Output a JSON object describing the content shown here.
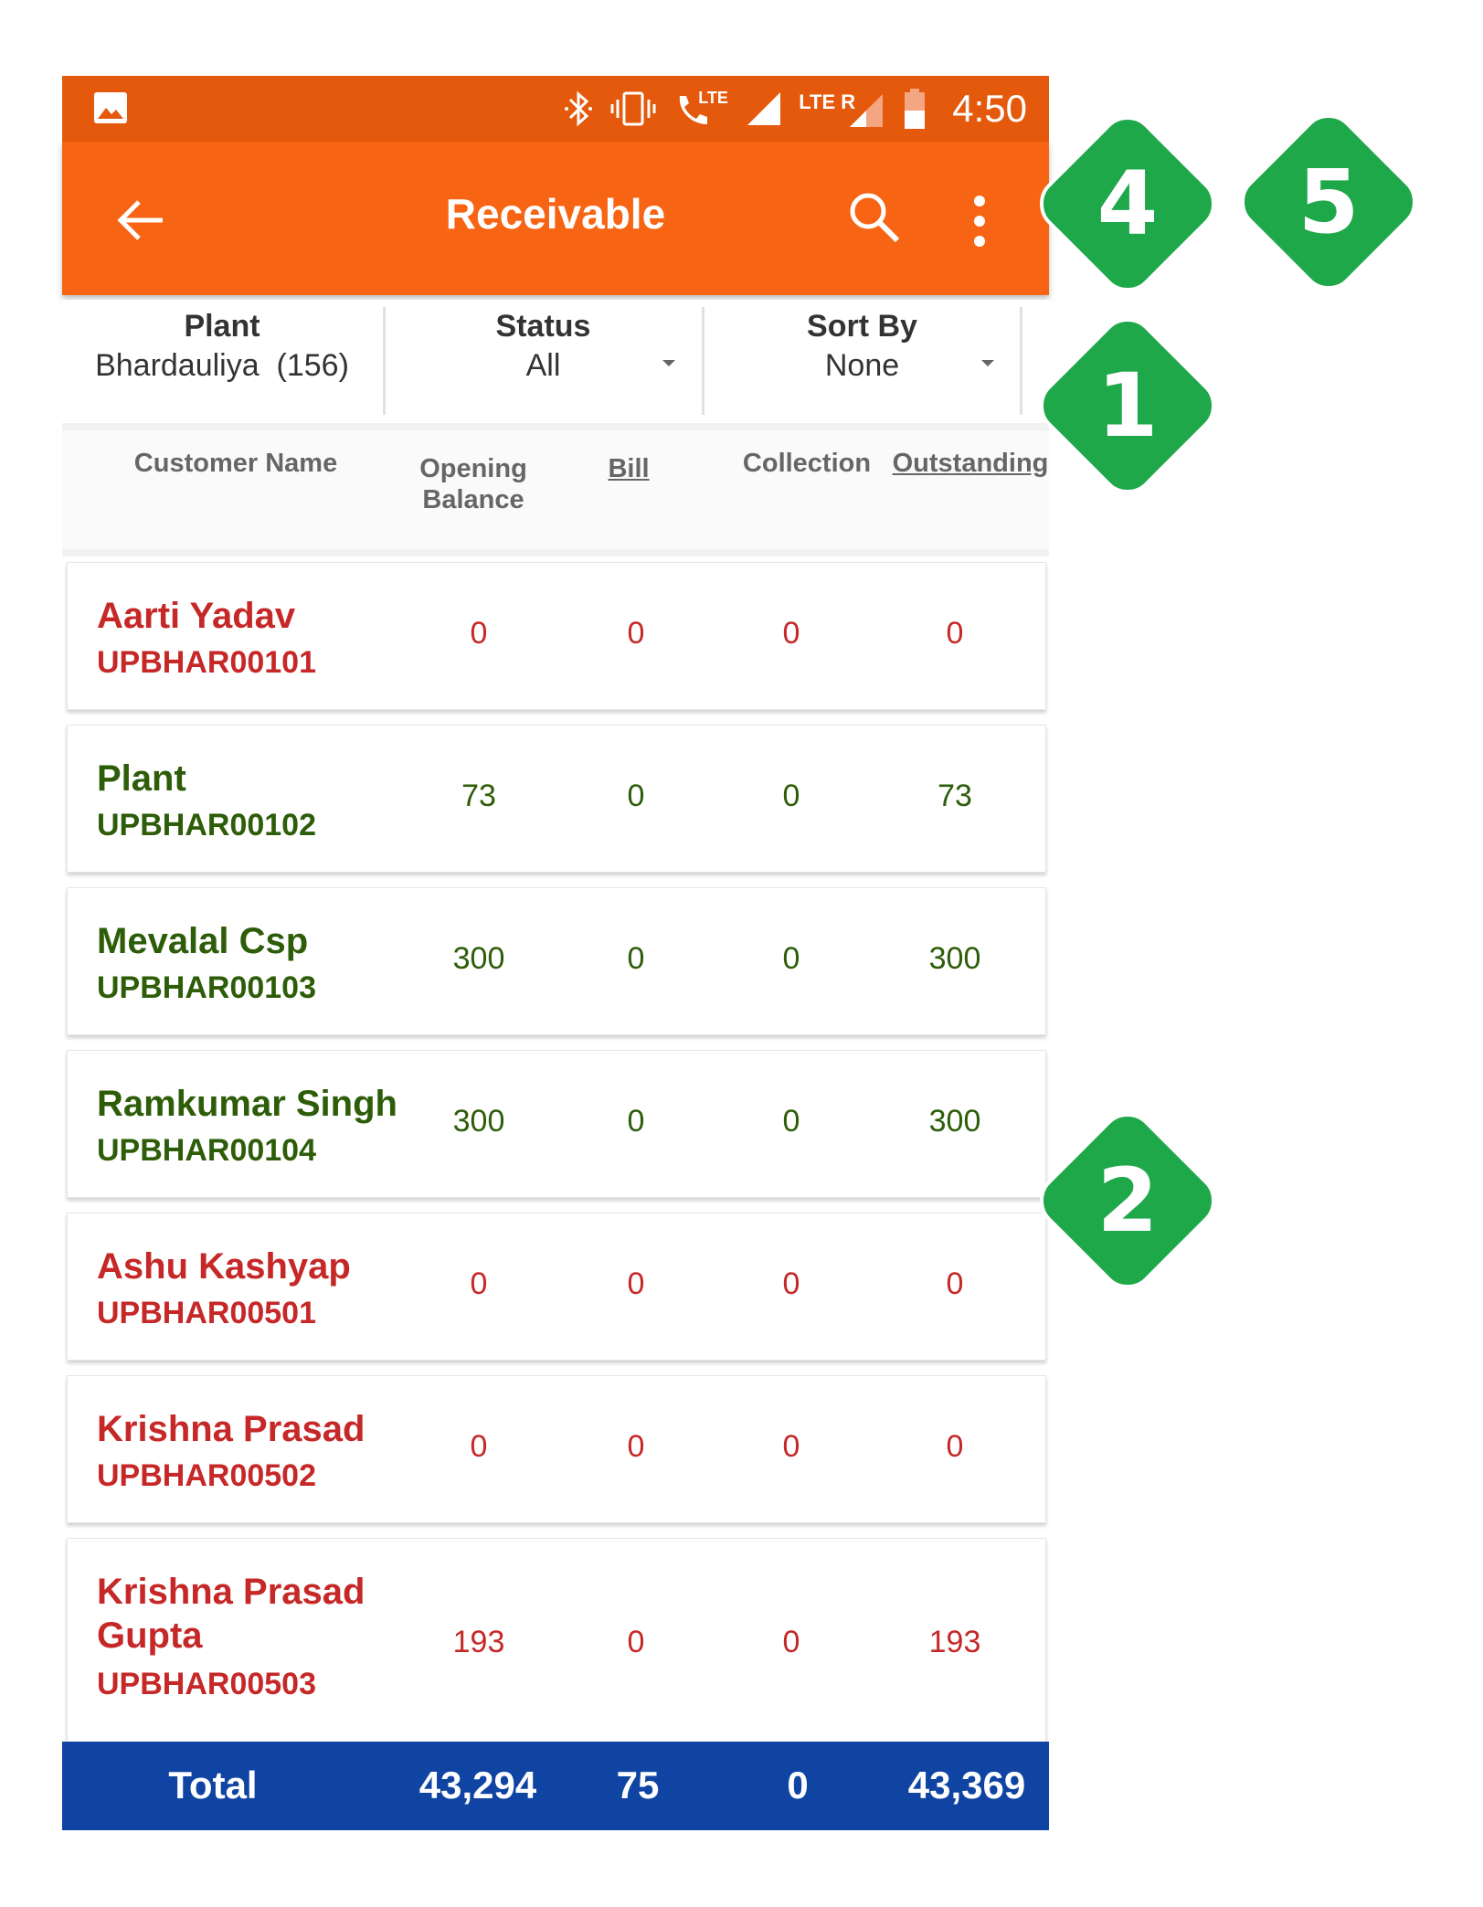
{
  "status_bar": {
    "time": "4:50",
    "lte": "LTE",
    "lte_r": "LTE R",
    "call_lte": "LTE"
  },
  "app_bar": {
    "title": "Receivable"
  },
  "filters": {
    "plant": {
      "label": "Plant",
      "value": "Bhardauliya  (156)"
    },
    "status": {
      "label": "Status",
      "value": "All"
    },
    "sort_by": {
      "label": "Sort By",
      "value": "None"
    }
  },
  "columns": {
    "customer_name": "Customer Name",
    "opening_balance_1": "Opening",
    "opening_balance_2": "Balance",
    "bill": "Bill",
    "collection": "Collection",
    "outstanding": "Outstanding"
  },
  "rows": [
    {
      "name": "Aarti Yadav",
      "code": "UPBHAR00101",
      "opening": "0",
      "bill": "0",
      "collection": "0",
      "outstanding": "0",
      "color": "#c62828"
    },
    {
      "name": "Plant",
      "code": "UPBHAR00102",
      "opening": "73",
      "bill": "0",
      "collection": "0",
      "outstanding": "73",
      "color": "#2e5d09"
    },
    {
      "name": "Mevalal Csp",
      "code": "UPBHAR00103",
      "opening": "300",
      "bill": "0",
      "collection": "0",
      "outstanding": "300",
      "color": "#2e5d09"
    },
    {
      "name": "Ramkumar Singh",
      "code": "UPBHAR00104",
      "opening": "300",
      "bill": "0",
      "collection": "0",
      "outstanding": "300",
      "color": "#2e5d09"
    },
    {
      "name": "Ashu Kashyap",
      "code": "UPBHAR00501",
      "opening": "0",
      "bill": "0",
      "collection": "0",
      "outstanding": "0",
      "color": "#c62828"
    },
    {
      "name": "Krishna Prasad",
      "code": "UPBHAR00502",
      "opening": "0",
      "bill": "0",
      "collection": "0",
      "outstanding": "0",
      "color": "#c62828"
    },
    {
      "name": "Krishna  Prasad Gupta",
      "code": "UPBHAR00503",
      "opening": "193",
      "bill": "0",
      "collection": "0",
      "outstanding": "193",
      "color": "#c62828"
    }
  ],
  "total": {
    "label": "Total",
    "opening": "43,294",
    "bill": "75",
    "collection": "0",
    "outstanding": "43,369"
  },
  "badges": {
    "b4": "4",
    "b5": "5",
    "b1": "1",
    "b2": "2"
  },
  "colors": {
    "status_bar": "#e4590b",
    "app_bar": "#f76413",
    "total_bar": "#0f44a3",
    "badge": "#1fa84a",
    "red": "#c62828",
    "green": "#2e5d09"
  }
}
